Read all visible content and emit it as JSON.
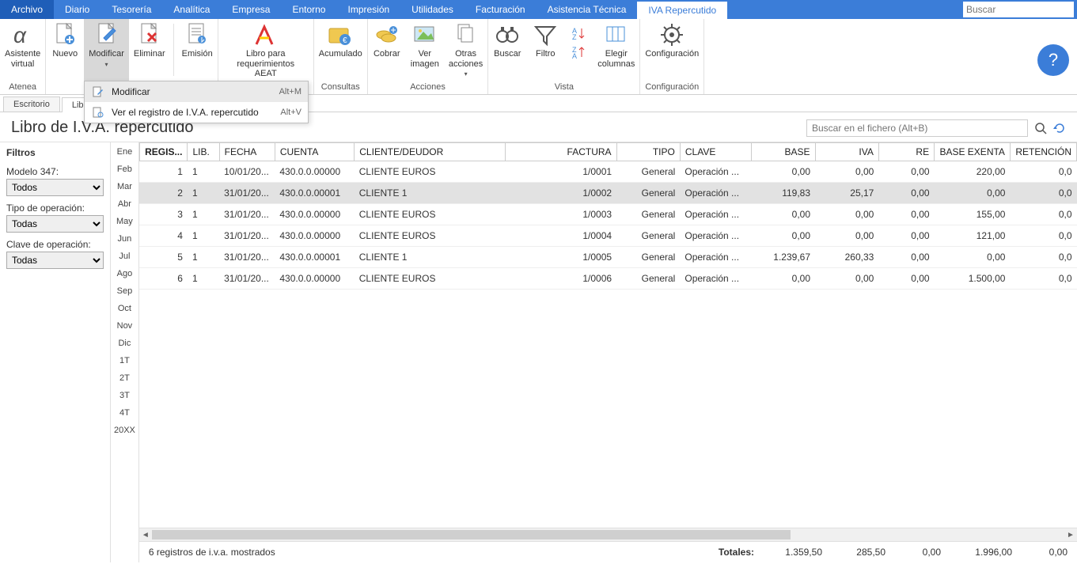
{
  "menu": {
    "items": [
      "Archivo",
      "Diario",
      "Tesorería",
      "Analítica",
      "Empresa",
      "Entorno",
      "Impresión",
      "Utilidades",
      "Facturación",
      "Asistencia Técnica",
      "IVA Repercutido"
    ],
    "active_index": 10,
    "search_placeholder": "Buscar"
  },
  "ribbon": {
    "groups": [
      {
        "label": "Atenea",
        "buttons": [
          {
            "name": "asistente-virtual",
            "label": "Asistente\nvirtual"
          }
        ]
      },
      {
        "label": "",
        "buttons": [
          {
            "name": "nuevo",
            "label": "Nuevo"
          },
          {
            "name": "modificar",
            "label": "Modificar",
            "active": true,
            "drop": true
          },
          {
            "name": "eliminar",
            "label": "Eliminar"
          },
          {
            "name": "spacer"
          },
          {
            "name": "emision",
            "label": "Emisión"
          }
        ]
      },
      {
        "label": "",
        "buttons": [
          {
            "name": "libro-aeat",
            "label": "Libro para\nrequerimientos AEAT"
          }
        ]
      },
      {
        "label": "Consultas",
        "buttons": [
          {
            "name": "acumulado",
            "label": "Acumulado"
          }
        ]
      },
      {
        "label": "Acciones",
        "buttons": [
          {
            "name": "cobrar",
            "label": "Cobrar"
          },
          {
            "name": "ver-imagen",
            "label": "Ver\nimagen"
          },
          {
            "name": "otras-acciones",
            "label": "Otras\nacciones",
            "drop": true
          }
        ]
      },
      {
        "label": "Vista",
        "buttons": [
          {
            "name": "buscar",
            "label": "Buscar"
          },
          {
            "name": "filtro",
            "label": "Filtro"
          },
          {
            "name": "ordenar",
            "label": ""
          },
          {
            "name": "elegir-columnas",
            "label": "Elegir\ncolumnas"
          }
        ]
      },
      {
        "label": "Configuración",
        "buttons": [
          {
            "name": "configuracion",
            "label": "Configuración"
          }
        ]
      }
    ]
  },
  "dropdown": {
    "items": [
      {
        "label": "Modificar",
        "shortcut": "Alt+M",
        "hov": true
      },
      {
        "label": "Ver el registro de I.V.A. repercutido",
        "shortcut": "Alt+V"
      }
    ]
  },
  "doc_tabs": {
    "items": [
      "Escritorio",
      "Libro"
    ],
    "active_index": 1
  },
  "page_title": "Libro de I.V.A. repercutido",
  "search_file_placeholder": "Buscar en el fichero (Alt+B)",
  "filters": {
    "title": "Filtros",
    "modelo_label": "Modelo 347:",
    "modelo_value": "Todos",
    "tipo_label": "Tipo de operación:",
    "tipo_value": "Todas",
    "clave_label": "Clave de operación:",
    "clave_value": "Todas"
  },
  "months": [
    "Ene",
    "Feb",
    "Mar",
    "Abr",
    "May",
    "Jun",
    "Jul",
    "Ago",
    "Sep",
    "Oct",
    "Nov",
    "Dic",
    "1T",
    "2T",
    "3T",
    "4T",
    "20XX"
  ],
  "table": {
    "headers": [
      "REGIS...",
      "LIB.",
      "FECHA",
      "CUENTA",
      "CLIENTE/DEUDOR",
      "FACTURA",
      "TIPO",
      "CLAVE",
      "BASE",
      "IVA",
      "RE",
      "BASE EXENTA",
      "RETENCIÓN"
    ],
    "rows": [
      {
        "regis": "1",
        "lib": "1",
        "fecha": "10/01/20...",
        "cuenta": "430.0.0.00000",
        "cliente": "CLIENTE EUROS",
        "factura": "1/0001",
        "tipo": "General",
        "clave": "Operación ...",
        "base": "0,00",
        "iva": "0,00",
        "re": "0,00",
        "exenta": "220,00",
        "ret": "0,0"
      },
      {
        "regis": "2",
        "lib": "1",
        "fecha": "31/01/20...",
        "cuenta": "430.0.0.00001",
        "cliente": "CLIENTE 1",
        "factura": "1/0002",
        "tipo": "General",
        "clave": "Operación ...",
        "base": "119,83",
        "iva": "25,17",
        "re": "0,00",
        "exenta": "0,00",
        "ret": "0,0",
        "selected": true
      },
      {
        "regis": "3",
        "lib": "1",
        "fecha": "31/01/20...",
        "cuenta": "430.0.0.00000",
        "cliente": "CLIENTE EUROS",
        "factura": "1/0003",
        "tipo": "General",
        "clave": "Operación ...",
        "base": "0,00",
        "iva": "0,00",
        "re": "0,00",
        "exenta": "155,00",
        "ret": "0,0"
      },
      {
        "regis": "4",
        "lib": "1",
        "fecha": "31/01/20...",
        "cuenta": "430.0.0.00000",
        "cliente": "CLIENTE EUROS",
        "factura": "1/0004",
        "tipo": "General",
        "clave": "Operación ...",
        "base": "0,00",
        "iva": "0,00",
        "re": "0,00",
        "exenta": "121,00",
        "ret": "0,0"
      },
      {
        "regis": "5",
        "lib": "1",
        "fecha": "31/01/20...",
        "cuenta": "430.0.0.00001",
        "cliente": "CLIENTE 1",
        "factura": "1/0005",
        "tipo": "General",
        "clave": "Operación ...",
        "base": "1.239,67",
        "iva": "260,33",
        "re": "0,00",
        "exenta": "0,00",
        "ret": "0,0"
      },
      {
        "regis": "6",
        "lib": "1",
        "fecha": "31/01/20...",
        "cuenta": "430.0.0.00000",
        "cliente": "CLIENTE EUROS",
        "factura": "1/0006",
        "tipo": "General",
        "clave": "Operación ...",
        "base": "0,00",
        "iva": "0,00",
        "re": "0,00",
        "exenta": "1.500,00",
        "ret": "0,0"
      }
    ]
  },
  "footer": {
    "status": "6 registros de i.v.a. mostrados",
    "totales_label": "Totales:",
    "totals": {
      "base": "1.359,50",
      "iva": "285,50",
      "re": "0,00",
      "exenta": "1.996,00",
      "ret": "0,00"
    }
  }
}
